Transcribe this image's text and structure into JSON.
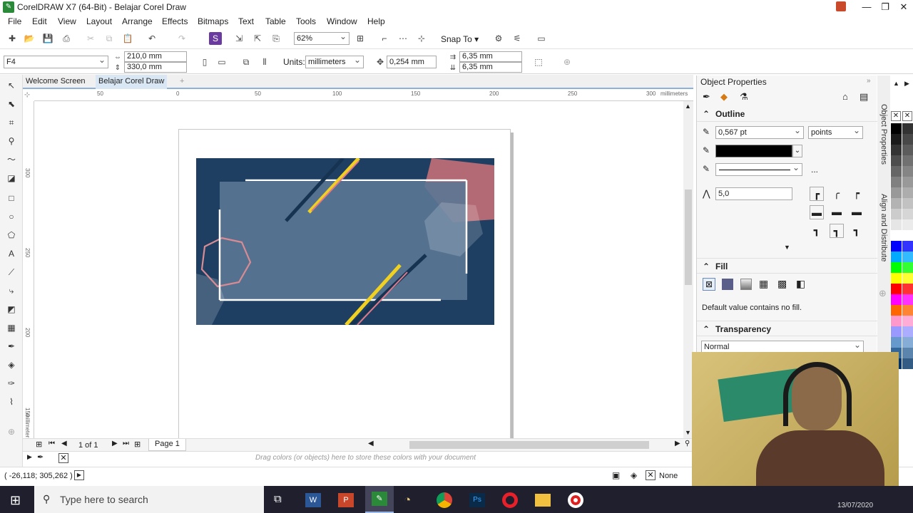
{
  "window": {
    "title": "CorelDRAW X7 (64-Bit) - Belajar Corel Draw"
  },
  "menu": [
    "File",
    "Edit",
    "View",
    "Layout",
    "Arrange",
    "Effects",
    "Bitmaps",
    "Text",
    "Table",
    "Tools",
    "Window",
    "Help"
  ],
  "toolbar": {
    "zoom": "62%",
    "snap_to": "Snap To"
  },
  "propbar": {
    "page_size": "F4",
    "width": "210,0 mm",
    "height": "330,0 mm",
    "units_label": "Units:",
    "units_value": "millimeters",
    "nudge": "0,254 mm",
    "dup_x": "6,35 mm",
    "dup_y": "6,35 mm"
  },
  "tabs": [
    "Welcome Screen",
    "Belajar Corel Draw"
  ],
  "ruler": {
    "h_ticks": [
      "50",
      "0",
      "50",
      "100",
      "150",
      "200",
      "250",
      "300"
    ],
    "unit": "millimeters",
    "v_ticks": [
      "300",
      "250",
      "200",
      "150"
    ],
    "v_unit": "millimeters"
  },
  "pagenav": {
    "count": "1 of 1",
    "page_tab": "Page 1"
  },
  "palette_hint": "Drag colors (or objects) here to store these colors with your document",
  "status": {
    "coords": "( -26,118; 305,262 )",
    "fill": "None"
  },
  "panel": {
    "title": "Object Properties",
    "outline": {
      "head": "Outline",
      "width": "0,567 pt",
      "unit": "points",
      "miter": "5,0",
      "more": "..."
    },
    "fill": {
      "head": "Fill",
      "note": "Default value contains no fill."
    },
    "transparency": {
      "head": "Transparency",
      "mode": "Normal"
    }
  },
  "dockers": [
    "Object Properties",
    "Align and Distribute"
  ],
  "taskbar": {
    "search": "Type here to search",
    "date": "13/07/2020"
  },
  "colors": {
    "accent": "#1e3f62",
    "card_inner": "#5a7795",
    "hex_pink": "#b46a74",
    "stripe_yellow": "#f0d020",
    "swatches": [
      "#000000",
      "#1a1a1a",
      "#333333",
      "#4d4d4d",
      "#666666",
      "#808080",
      "#999999",
      "#b3b3b3",
      "#cccccc",
      "#e6e6e6",
      "#ffffff",
      "#0000ff",
      "#00aaff",
      "#00ff00",
      "#ffff00",
      "#ff0000",
      "#ff00ff",
      "#ff6600",
      "#ff99cc",
      "#9999ff",
      "#6699cc",
      "#336699",
      "#003366"
    ]
  }
}
